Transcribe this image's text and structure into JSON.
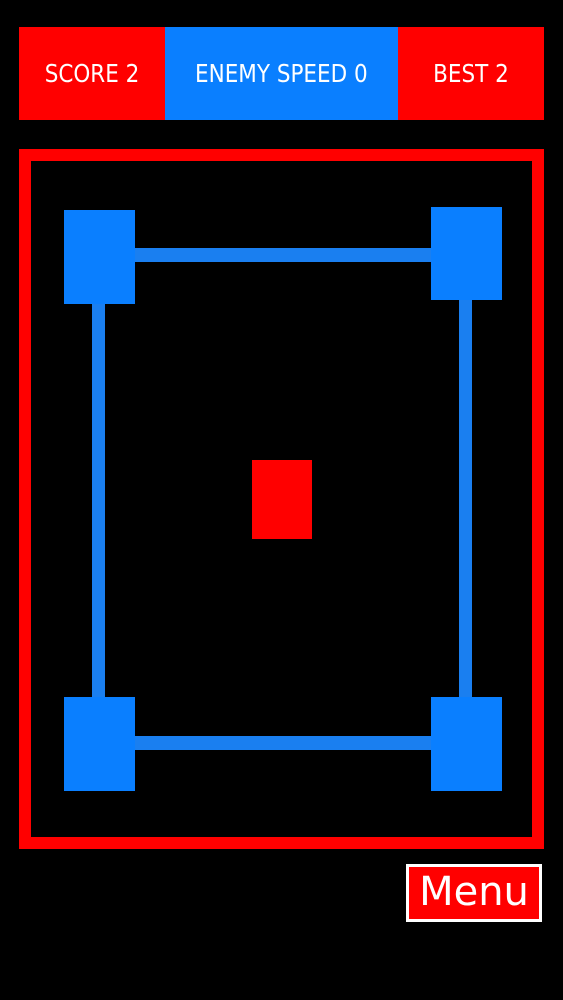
{
  "hud": {
    "score_label": "SCORE 2",
    "enemy_speed_label": "ENEMY SPEED 0",
    "best_label": "BEST 2"
  },
  "menu": {
    "button_label": "Menu"
  },
  "colors": {
    "background": "#000000",
    "red": "#ff0000",
    "blue": "#0a7fff",
    "text": "#ffffff"
  }
}
